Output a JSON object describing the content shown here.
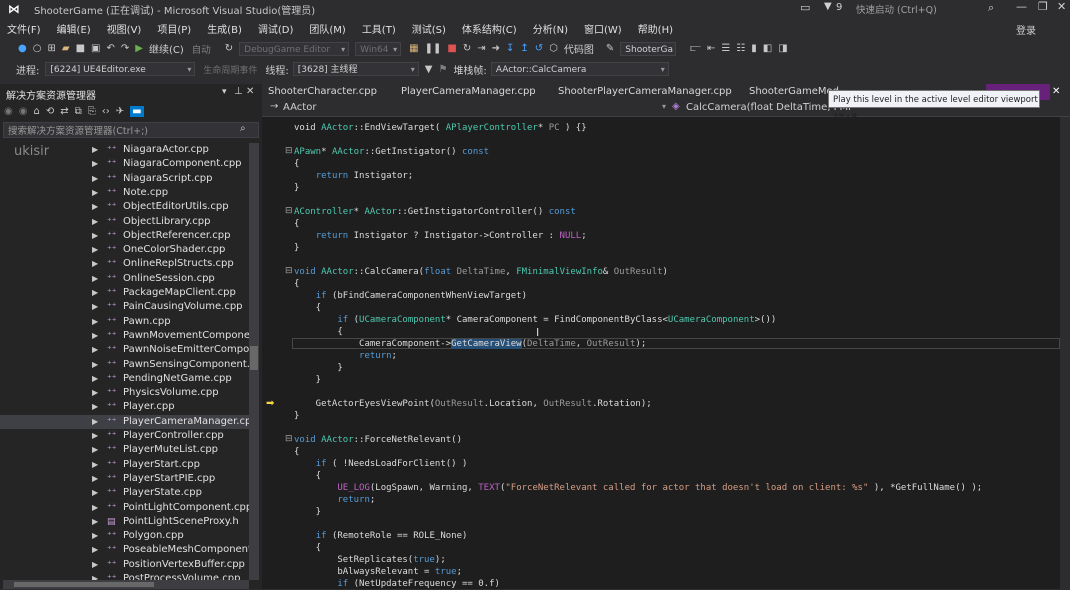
{
  "window": {
    "title": "ShooterGame (正在调试) - Microsoft Visual Studio(管理员)",
    "notification_count": "9",
    "quick_launch_placeholder": "快速启动 (Ctrl+Q)",
    "login": "登录"
  },
  "menu": [
    "文件(F)",
    "编辑(E)",
    "视图(V)",
    "项目(P)",
    "生成(B)",
    "调试(D)",
    "团队(M)",
    "工具(T)",
    "测试(S)",
    "体系结构(C)",
    "分析(N)",
    "窗口(W)",
    "帮助(H)"
  ],
  "toolbar": {
    "continue_label": "继续(C)",
    "auto_label": "自动",
    "config": "DebugGame Editor",
    "platform": "Win64",
    "code_map": "代码图",
    "project": "ShooterGa"
  },
  "debug_bar": {
    "process_label": "进程:",
    "process": "[6224] UE4Editor.exe",
    "lifecycle": "生命周期事件",
    "thread_label": "线程:",
    "thread": "[3628] 主线程",
    "stack_label": "堆栈帧:",
    "stack_frame": "AActor::CalcCamera"
  },
  "solution_explorer": {
    "title": "解决方案资源管理器",
    "search_placeholder": "搜索解决方案资源管理器(Ctrl+;)",
    "watermark": "ukisir",
    "items": [
      "NiagaraActor.cpp",
      "NiagaraComponent.cpp",
      "NiagaraScript.cpp",
      "Note.cpp",
      "ObjectEditorUtils.cpp",
      "ObjectLibrary.cpp",
      "ObjectReferencer.cpp",
      "OneColorShader.cpp",
      "OnlineReplStructs.cpp",
      "OnlineSession.cpp",
      "PackageMapClient.cpp",
      "PainCausingVolume.cpp",
      "Pawn.cpp",
      "PawnMovementComponent.",
      "PawnNoiseEmitterCompone",
      "PawnSensingComponent.cpp",
      "PendingNetGame.cpp",
      "PhysicsVolume.cpp",
      "Player.cpp",
      "PlayerCameraManager.cpp",
      "PlayerController.cpp",
      "PlayerMuteList.cpp",
      "PlayerStart.cpp",
      "PlayerStartPIE.cpp",
      "PlayerState.cpp",
      "PointLightComponent.cpp",
      "PointLightSceneProxy.h",
      "Polygon.cpp",
      "PoseableMeshComponent.c",
      "PositionVertexBuffer.cpp",
      "PostProcessVolume.cpp"
    ],
    "selected_index": 19
  },
  "tabs": [
    "ShooterCharacter.cpp",
    "PlayerCameraManager.cpp",
    "ShooterPlayerCameraManager.cpp",
    "ShooterGameMod"
  ],
  "nav": {
    "scope": "AActor",
    "member": "CalcCamera(float DeltaTime, FMi"
  },
  "tooltip": "Play this level in the active level editor viewport Alt+P",
  "colors": {
    "accent": "#68217a",
    "editor_bg": "#1e1e1e",
    "selection": "#264f78"
  }
}
